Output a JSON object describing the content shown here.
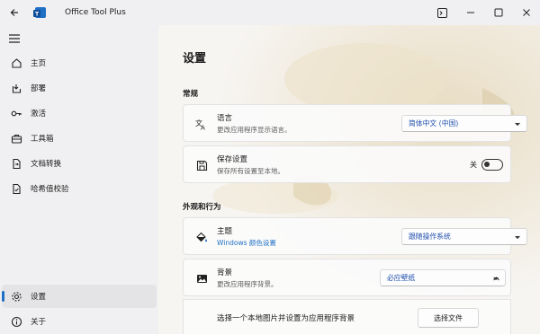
{
  "titlebar": {
    "title": "Office Tool Plus",
    "back_icon": "back-arrow-icon",
    "logo_icon": "office-tool-plus-logo",
    "buttons": [
      "terminal-icon",
      "minimize-icon",
      "maximize-icon",
      "close-icon"
    ]
  },
  "sidebar": {
    "items": [
      {
        "label": "主页",
        "icon": "home-icon"
      },
      {
        "label": "部署",
        "icon": "deploy-icon"
      },
      {
        "label": "激活",
        "icon": "key-icon"
      },
      {
        "label": "工具箱",
        "icon": "toolbox-icon"
      },
      {
        "label": "文档转换",
        "icon": "document-convert-icon"
      },
      {
        "label": "哈希值校验",
        "icon": "hash-check-icon"
      }
    ],
    "footer": [
      {
        "label": "设置",
        "icon": "gear-icon"
      },
      {
        "label": "关于",
        "icon": "info-icon"
      }
    ],
    "active": "设置",
    "accent": "#1f6fc5"
  },
  "main": {
    "title": "设置",
    "sections": {
      "general": "常规",
      "appearance": "外观和行为"
    },
    "language": {
      "title": "语言",
      "subtitle": "更改应用程序显示语言。",
      "value": "简体中文 (中国)"
    },
    "save_settings": {
      "title": "保存设置",
      "subtitle": "保存所有设置至本地。",
      "state_label": "关",
      "on": false
    },
    "theme": {
      "title": "主题",
      "subtitle": "Windows 颜色设置",
      "value": "跟随操作系统"
    },
    "background": {
      "title": "背景",
      "subtitle": "更改应用程序背景。",
      "value": "必应壁纸",
      "expanded": true
    },
    "background_local": {
      "text": "选择一个本地图片并设置为应用程序背景",
      "button": "选择文件"
    }
  }
}
